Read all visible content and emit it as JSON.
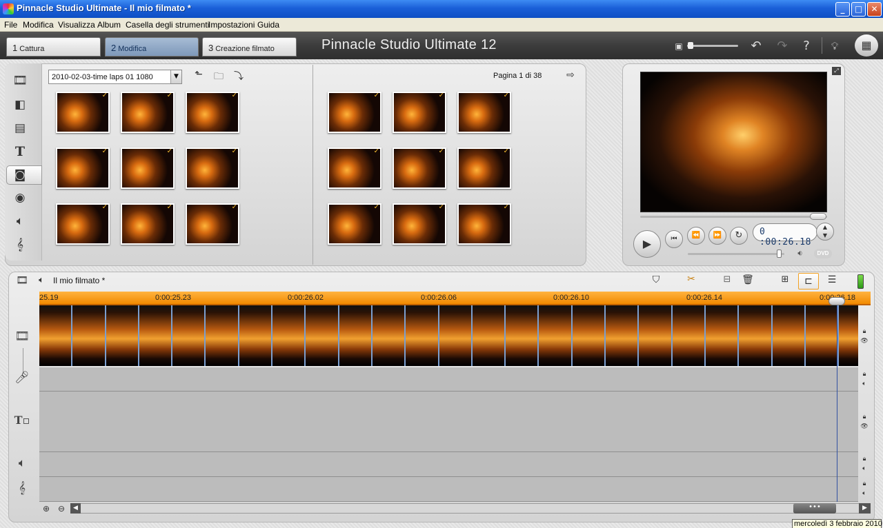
{
  "window": {
    "title": "Pinnacle Studio Ultimate - Il mio filmato *",
    "min": "_",
    "max": "□",
    "close": "✕"
  },
  "menu": [
    "File",
    "Modifica",
    "Visualizza",
    "Album",
    "Casella degli strumenti",
    "Impostazioni",
    "Guida"
  ],
  "tabs": [
    {
      "num": "1",
      "label": "Cattura",
      "active": false
    },
    {
      "num": "2",
      "label": "Modifica",
      "active": true
    },
    {
      "num": "3",
      "label": "Creazione filmato",
      "active": false
    }
  ],
  "brand": "Pinnacle Studio Ultimate 12",
  "album": {
    "folder": "2010-02-03-time laps 01 1080",
    "page": "Pagina 1 di 38"
  },
  "player": {
    "timecode": "0 :00:26.18",
    "volume_level": 0.9
  },
  "timeline": {
    "project": "Il mio filmato *",
    "ruler": [
      "25.19",
      "0:00:25.23",
      "0:00:26.02",
      "0:00:26.06",
      "0:00:26.10",
      "0:00:26.14",
      "0:00:26.18"
    ]
  },
  "tooltip": "mercoledì 3 febbraio 2010",
  "colors": {
    "accent": "#f28a00",
    "title_bar": "#1a5fd8",
    "tab_active": "#7e98b9"
  }
}
